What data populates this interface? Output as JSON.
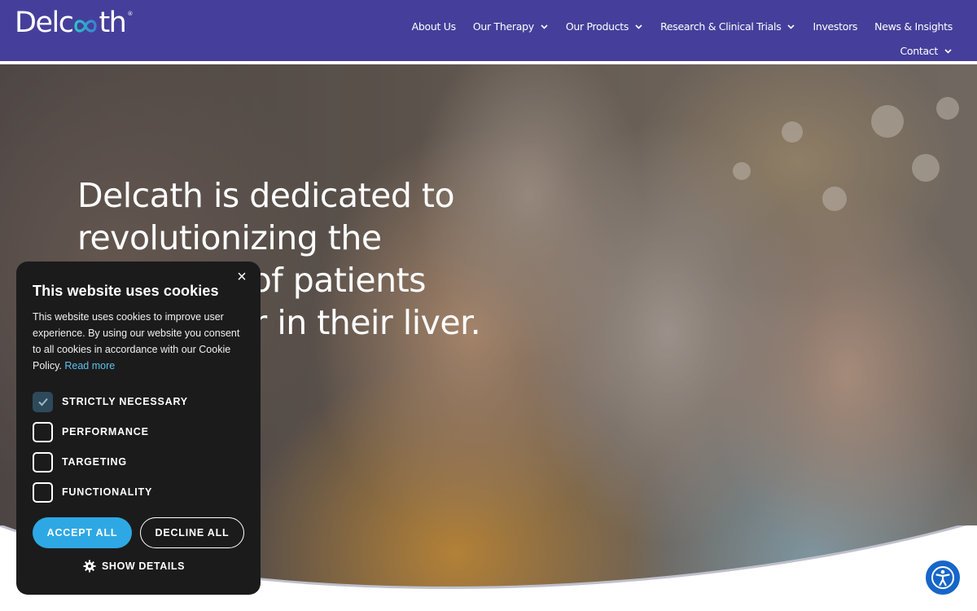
{
  "header": {
    "logo_text_left": "Delc",
    "logo_text_right": "th",
    "logo_mark": "®",
    "nav": [
      {
        "label": "About Us",
        "has_dropdown": false
      },
      {
        "label": "Our Therapy",
        "has_dropdown": true
      },
      {
        "label": "Our Products",
        "has_dropdown": true
      },
      {
        "label": "Research & Clinical Trials",
        "has_dropdown": true
      },
      {
        "label": "Investors",
        "has_dropdown": false
      },
      {
        "label": "News & Insights",
        "has_dropdown": false
      },
      {
        "label": "Contact",
        "has_dropdown": true
      }
    ]
  },
  "hero": {
    "title": "Delcath is dedicated to revolutionizing the treatment of patients with cancer in their liver."
  },
  "cookie_banner": {
    "close_glyph": "×",
    "title": "This website uses cookies",
    "body": "This website uses cookies to improve user experience. By using our website you consent to all cookies in accordance with our Cookie Policy.",
    "read_more": "Read more",
    "options": [
      {
        "label": "STRICTLY NECESSARY",
        "checked": true
      },
      {
        "label": "PERFORMANCE",
        "checked": false
      },
      {
        "label": "TARGETING",
        "checked": false
      },
      {
        "label": "FUNCTIONALITY",
        "checked": false
      }
    ],
    "accept_label": "ACCEPT ALL",
    "decline_label": "DECLINE ALL",
    "details_label": "SHOW DETAILS"
  },
  "colors": {
    "header_bg": "#453f9b",
    "cookie_bg": "#1b1b1c",
    "accept_bg": "#2ea8e4",
    "link": "#5cc3ec",
    "a11y_bg": "#1666c8"
  },
  "icons": {
    "nav_dropdown": "chevron-down-icon",
    "close": "close-icon",
    "checkbox": "checkmark-icon",
    "details": "gear-icon",
    "accessibility": "accessibility-person-icon"
  }
}
